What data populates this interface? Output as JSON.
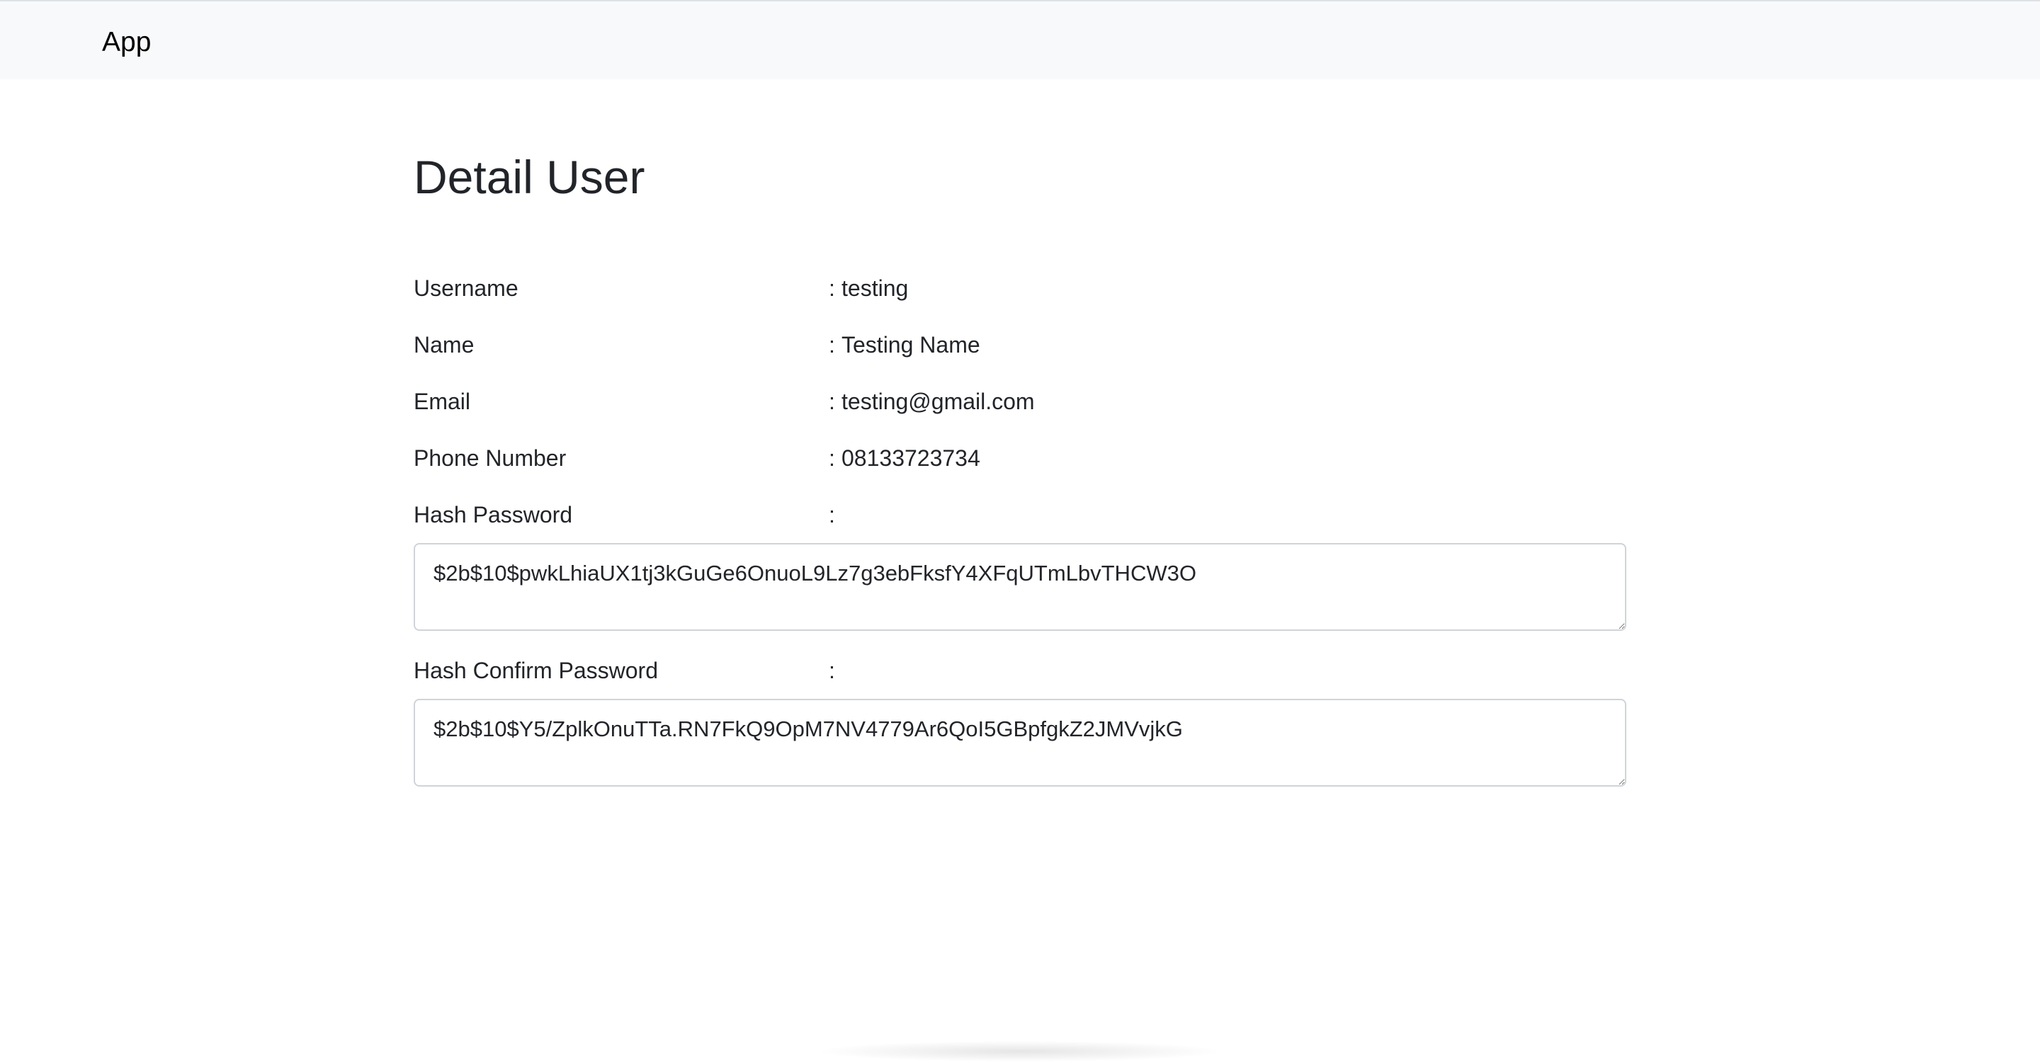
{
  "navbar": {
    "brand": "App"
  },
  "page": {
    "title": "Detail User"
  },
  "fields": {
    "username": {
      "label": "Username",
      "sep": ":",
      "value": "testing"
    },
    "name": {
      "label": "Name",
      "sep": ":",
      "value": "Testing Name"
    },
    "email": {
      "label": "Email",
      "sep": ":",
      "value": "testing@gmail.com"
    },
    "phone": {
      "label": "Phone Number",
      "sep": ":",
      "value": "08133723734"
    },
    "hash_password": {
      "label": "Hash Password",
      "sep": ":",
      "value": "$2b$10$pwkLhiaUX1tj3kGuGe6OnuoL9Lz7g3ebFksfY4XFqUTmLbvTHCW3O"
    },
    "hash_confirm_password": {
      "label": "Hash Confirm Password",
      "sep": ":",
      "value": "$2b$10$Y5/ZplkOnuTTa.RN7FkQ9OpM7NV4779Ar6QoI5GBpfgkZ2JMVvjkG"
    }
  }
}
